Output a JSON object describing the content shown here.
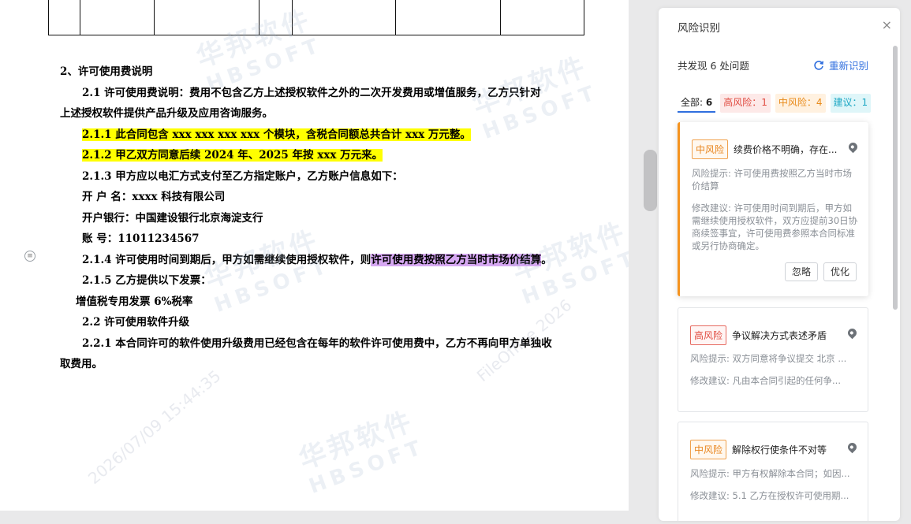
{
  "document": {
    "heading": "2、许可使用费说明",
    "p1_line1": "2.1 许可使用费说明：费用不包含乙方上述授权软件之外的二次开发费用或增值服务，乙方只针对",
    "p1_line2": "上述授权软件提供产品升级及应用咨询服务。",
    "p2": "2.1.1 此合同包含 xxx xxx xxx xxx 个模块，含税合同额总共合计 xxx 万元整。",
    "p3": "2.1.2 甲乙双方同意后续 2024 年、2025 年按 xxx 万元来。",
    "p4": "2.1.3 甲方应以电汇方式支付至乙方指定账户，乙方账户信息如下：",
    "p5": "开 户 名：xxxx 科技有限公司",
    "p6": "开户银行：中国建设银行北京海淀支行",
    "p7": "账 号：11011234567",
    "p8_pre": "2.1.4 许可使用时间到期后，甲方如需继续使用授权软件，则",
    "p8_hl": "许可使用费按照乙方当时市场价结算",
    "p8_post": "。",
    "p9": "2.1.5 乙方提供以下发票：",
    "p10": "增值税专用发票 6%税率",
    "p11": "2.2 许可使用软件升级",
    "p12_line1": "2.2.1 本合同许可的软件使用升级费用已经包含在每年的软件许可使用费中，乙方不再向甲方单独收",
    "p12_line2": "取费用。",
    "margin_icon": "≡"
  },
  "watermark": {
    "cn": "华邦软件",
    "en": "HBSOFT",
    "date": "2026/07/09 15:44:35",
    "file": "FileOffice 2026"
  },
  "panel": {
    "title": "风险识别",
    "close": "×",
    "found": "共发现 6 处问题",
    "refresh_label": "重新识别",
    "tabs": {
      "all_label": "全部:",
      "all_count": "6",
      "high": "高风险：1",
      "mid": "中风险：4",
      "suggest": "建议：1"
    },
    "cards": [
      {
        "level": "中风险",
        "title": "续费价格不明确，存在...",
        "hint": "风险提示: 许可使用费按照乙方当时市场价结算",
        "suggestion": "修改建议: 许可使用时间到期后，甲方如需继续使用授权软件，双方应提前30日协商续签事宜，许可使用费参照本合同标准或另行协商确定。",
        "ignore": "忽略",
        "optimize": "优化"
      },
      {
        "level": "高风险",
        "title": "争议解决方式表述矛盾",
        "hint": "风险提示: 双方同意将争议提交 北京 ...",
        "suggestion": "修改建议: 凡由本合同引起的任何争..."
      },
      {
        "level": "中风险",
        "title": "解除权行使条件不对等",
        "hint": "风险提示: 甲方有权解除本合同；如因...",
        "suggestion": "修改建议: 5.1 乙方在授权许可使用期..."
      }
    ]
  },
  "colors": {
    "highlight_yellow": "#ffff00",
    "highlight_purple": "#d6a8f2",
    "accent_blue": "#2f6ede",
    "risk_mid": "#e8841c",
    "risk_high": "#e04a3f",
    "suggest": "#1aa6c3"
  },
  "icons": [
    "close-icon",
    "refresh-icon",
    "location-pin-icon",
    "comment-margin-icon"
  ]
}
